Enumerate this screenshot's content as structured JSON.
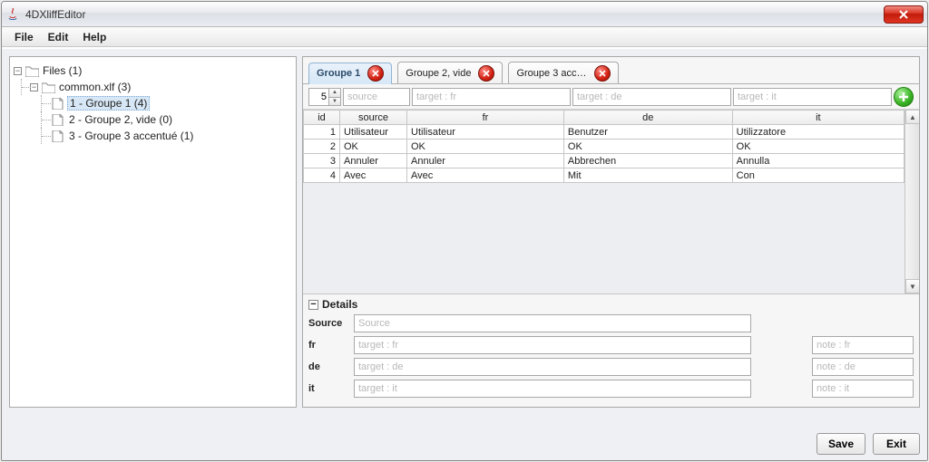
{
  "window": {
    "title": "4DXliffEditor"
  },
  "menu": {
    "file": "File",
    "edit": "Edit",
    "help": "Help"
  },
  "tree": {
    "root": "Files (1)",
    "file": "common.xlf (3)",
    "groups": [
      "1 - Groupe 1 (4)",
      "2 - Groupe 2, vide (0)",
      "3 - Groupe 3 accentué (1)"
    ]
  },
  "tabs": [
    {
      "label": "Groupe 1",
      "active": true
    },
    {
      "label": "Groupe 2, vide",
      "active": false
    },
    {
      "label": "Groupe 3 acc…",
      "active": false
    }
  ],
  "entry": {
    "idValue": "5",
    "placeholders": {
      "source": "source",
      "fr": "target : fr",
      "de": "target : de",
      "it": "target : it"
    }
  },
  "table": {
    "headers": {
      "id": "id",
      "source": "source",
      "fr": "fr",
      "de": "de",
      "it": "it"
    },
    "rows": [
      {
        "id": "1",
        "source": "Utilisateur",
        "fr": "Utilisateur",
        "de": "Benutzer",
        "it": "Utilizzatore"
      },
      {
        "id": "2",
        "source": "OK",
        "fr": "OK",
        "de": "OK",
        "it": "OK"
      },
      {
        "id": "3",
        "source": "Annuler",
        "fr": "Annuler",
        "de": "Abbrechen",
        "it": "Annulla"
      },
      {
        "id": "4",
        "source": "Avec",
        "fr": "Avec",
        "de": "Mit",
        "it": "Con"
      }
    ]
  },
  "details": {
    "title": "Details",
    "labels": {
      "source": "Source",
      "fr": "fr",
      "de": "de",
      "it": "it"
    },
    "placeholders": {
      "source": "Source",
      "fr": "target : fr",
      "de": "target : de",
      "it": "target : it",
      "note_fr": "note : fr",
      "note_de": "note : de",
      "note_it": "note : it"
    }
  },
  "footer": {
    "save": "Save",
    "exit": "Exit"
  }
}
